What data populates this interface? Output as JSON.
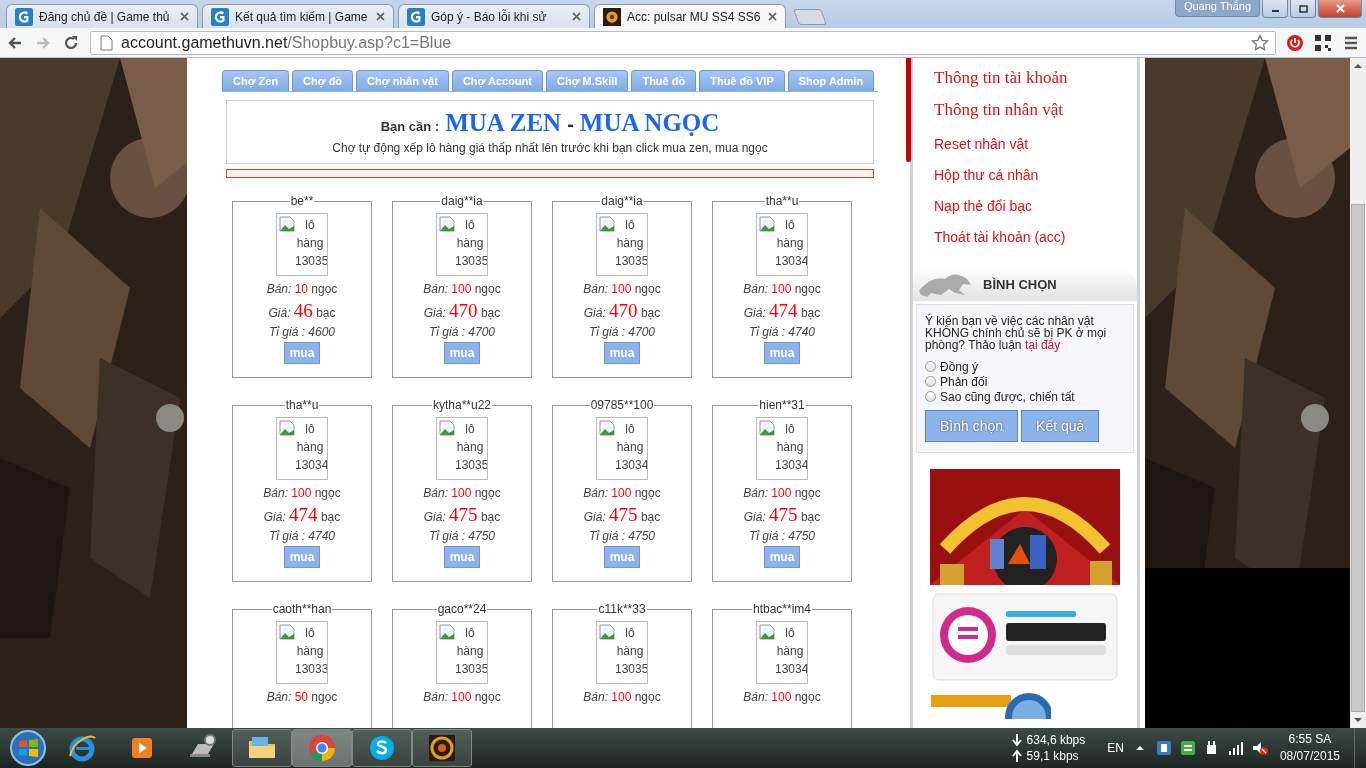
{
  "browser": {
    "tabs": [
      {
        "title": "Đăng chủ đề | Game thủ",
        "kind": "site",
        "selected": false
      },
      {
        "title": "Kết quả tìm kiếm | Game",
        "kind": "site",
        "selected": false
      },
      {
        "title": "Góp ý - Báo lỗi khi sử",
        "kind": "site",
        "selected": false
      },
      {
        "title": "Acc: pulsar MU SS4 SS6",
        "kind": "game",
        "selected": true
      }
    ],
    "user": "Quang Thắng",
    "url_host": "account.gamethuvn.net",
    "url_path": "/Shopbuy.asp?c1=Blue"
  },
  "page": {
    "nav_tabs": [
      "Chợ Zen",
      "Chợ đồ",
      "Chợ nhân vật",
      "Chợ Account",
      "Chợ M.Skill",
      "Thuê đồ",
      "Thuê đồ VIP",
      "Shop Admin"
    ],
    "heading": {
      "prefix": "Bạn cần :",
      "title_1": "MUA ZEN",
      "separator": "-",
      "title_2": "MUA NGỌC",
      "note": "Chợ tự động xếp lô hàng giá thấp nhất lên trước khi bạn click mua zen, mua ngọc"
    },
    "listings": [
      {
        "seller": "be**",
        "alt": "lô hàng 13035",
        "sell_label": "Bán:",
        "sell": "10",
        "sell_unit": "ngọc",
        "price_label": "Giá:",
        "price": "46",
        "price_unit": "bạc",
        "rate": "Tỉ giá : 4600",
        "button": "mua"
      },
      {
        "seller": "daig**ia",
        "alt": "lô hàng 13035",
        "sell_label": "Bán:",
        "sell": "100",
        "sell_unit": "ngọc",
        "price_label": "Giá:",
        "price": "470",
        "price_unit": "bạc",
        "rate": "Tỉ giá : 4700",
        "button": "mua"
      },
      {
        "seller": "daig**ia",
        "alt": "lô hàng 13035",
        "sell_label": "Bán:",
        "sell": "100",
        "sell_unit": "ngọc",
        "price_label": "Giá:",
        "price": "470",
        "price_unit": "bạc",
        "rate": "Tỉ giá : 4700",
        "button": "mua"
      },
      {
        "seller": "tha**u",
        "alt": "lô hàng 13034",
        "sell_label": "Bán:",
        "sell": "100",
        "sell_unit": "ngọc",
        "price_label": "Giá:",
        "price": "474",
        "price_unit": "bạc",
        "rate": "Tỉ giá : 4740",
        "button": "mua"
      },
      {
        "seller": "tha**u",
        "alt": "lô hàng 13034",
        "sell_label": "Bán:",
        "sell": "100",
        "sell_unit": "ngọc",
        "price_label": "Giá:",
        "price": "474",
        "price_unit": "bạc",
        "rate": "Tỉ giá : 4740",
        "button": "mua"
      },
      {
        "seller": "kytha**u22",
        "alt": "lô hàng 13035",
        "sell_label": "Bán:",
        "sell": "100",
        "sell_unit": "ngọc",
        "price_label": "Giá:",
        "price": "475",
        "price_unit": "bạc",
        "rate": "Tỉ giá : 4750",
        "button": "mua"
      },
      {
        "seller": "09785**100",
        "alt": "lô hàng 13034",
        "sell_label": "Bán:",
        "sell": "100",
        "sell_unit": "ngọc",
        "price_label": "Giá:",
        "price": "475",
        "price_unit": "bạc",
        "rate": "Tỉ giá : 4750",
        "button": "mua"
      },
      {
        "seller": "hien**31",
        "alt": "lô hàng 13034",
        "sell_label": "Bán:",
        "sell": "100",
        "sell_unit": "ngọc",
        "price_label": "Giá:",
        "price": "475",
        "price_unit": "bạc",
        "rate": "Tỉ giá : 4750",
        "button": "mua"
      },
      {
        "seller": "caoth**han",
        "alt": "lô hàng 13033",
        "sell_label": "Bán:",
        "sell": "50",
        "sell_unit": "ngọc"
      },
      {
        "seller": "gaco**24",
        "alt": "lô hàng 13035",
        "sell_label": "Bán:",
        "sell": "100",
        "sell_unit": "ngọc"
      },
      {
        "seller": "c11k**33",
        "alt": "lô hàng 13035",
        "sell_label": "Bán:",
        "sell": "100",
        "sell_unit": "ngọc"
      },
      {
        "seller": "htbac**im4",
        "alt": "lô hàng 13034",
        "sell_label": "Bán:",
        "sell": "100",
        "sell_unit": "ngọc"
      }
    ]
  },
  "sidebar": {
    "menu": [
      {
        "label": "Thông tin tài khoản",
        "kind": "large"
      },
      {
        "label": "Thông tin nhân vật",
        "kind": "large"
      },
      {
        "label": "Reset nhân vật",
        "kind": "small"
      },
      {
        "label": "Hộp thư cá nhân",
        "kind": "small"
      },
      {
        "label": "Nạp thẻ đổi bạc",
        "kind": "small"
      },
      {
        "label": "Thoát tài khoản (acc)",
        "kind": "small"
      }
    ],
    "poll": {
      "title": "BÌNH CHỌN",
      "question": "Ý kiến bạn về việc các nhân vật KHÔNG chính chủ sẽ bị PK ở mọi phòng? Thảo luận ",
      "link": "tại đây",
      "options": [
        {
          "label": "Đồng ý",
          "selected": false
        },
        {
          "label": "Phản đối",
          "selected": false
        },
        {
          "label": "Sao cũng được, chiến tất",
          "selected": false
        }
      ],
      "buttons": [
        "Bình chọn",
        "Kết quả"
      ]
    },
    "banners": [
      {
        "kind": "casino"
      },
      {
        "kind": "chat"
      },
      {
        "kind": "insurance"
      }
    ]
  },
  "taskbar": {
    "apps": [
      {
        "kind": "ie",
        "running": false,
        "selected": false
      },
      {
        "kind": "media",
        "running": false,
        "selected": false
      },
      {
        "kind": "tool",
        "running": false,
        "selected": false
      },
      {
        "kind": "explorer",
        "running": true,
        "selected": false
      },
      {
        "kind": "chrome",
        "running": true,
        "selected": true
      },
      {
        "kind": "skype",
        "running": true,
        "selected": false
      },
      {
        "kind": "game",
        "running": true,
        "selected": false
      }
    ],
    "net_down": "634,6 kbps",
    "net_up": "59,1 kbps",
    "language": "EN",
    "time": "6:55 SA",
    "date": "08/07/2015"
  }
}
